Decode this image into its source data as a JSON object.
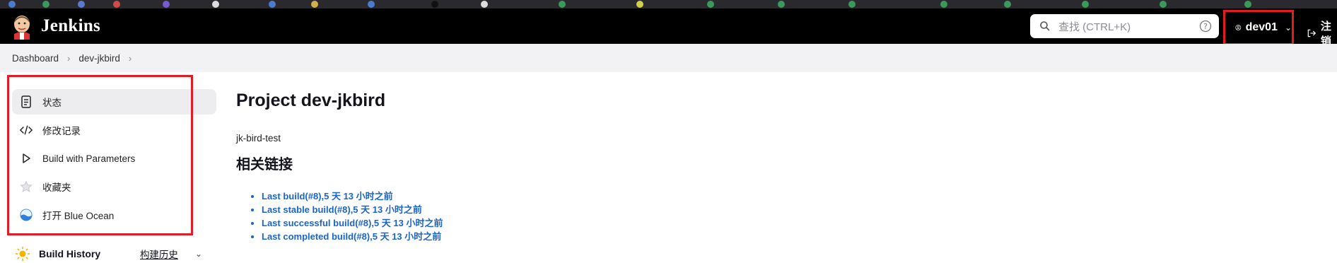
{
  "colors": {
    "header_bg": "#000000",
    "highlight_border": "#e01c24",
    "link": "#1a64c8",
    "sidebar_active_bg": "#ededf0"
  },
  "header": {
    "logo_text": "Jenkins",
    "search_placeholder": "查找 (CTRL+K)",
    "user_name": "dev01",
    "logout_label": "注销"
  },
  "breadcrumb": {
    "items": [
      "Dashboard",
      "dev-jkbird"
    ]
  },
  "sidebar": {
    "items": [
      {
        "label": "状态",
        "icon": "document-icon"
      },
      {
        "label": "修改记录",
        "icon": "code-icon"
      },
      {
        "label": "Build with Parameters",
        "icon": "play-icon"
      },
      {
        "label": "收藏夹",
        "icon": "star-icon"
      },
      {
        "label": "打开 Blue Ocean",
        "icon": "blue-ocean-icon"
      }
    ],
    "build_history": {
      "label": "Build History",
      "trend_label": "构建历史"
    }
  },
  "main": {
    "title": "Project dev-jkbird",
    "description": "jk-bird-test",
    "related_links_heading": "相关链接",
    "links": [
      "Last build(#8),5 天 13 小时之前",
      "Last stable build(#8),5 天 13 小时之前",
      "Last successful build(#8),5 天 13 小时之前",
      "Last completed build(#8),5 天 13 小时之前"
    ]
  }
}
